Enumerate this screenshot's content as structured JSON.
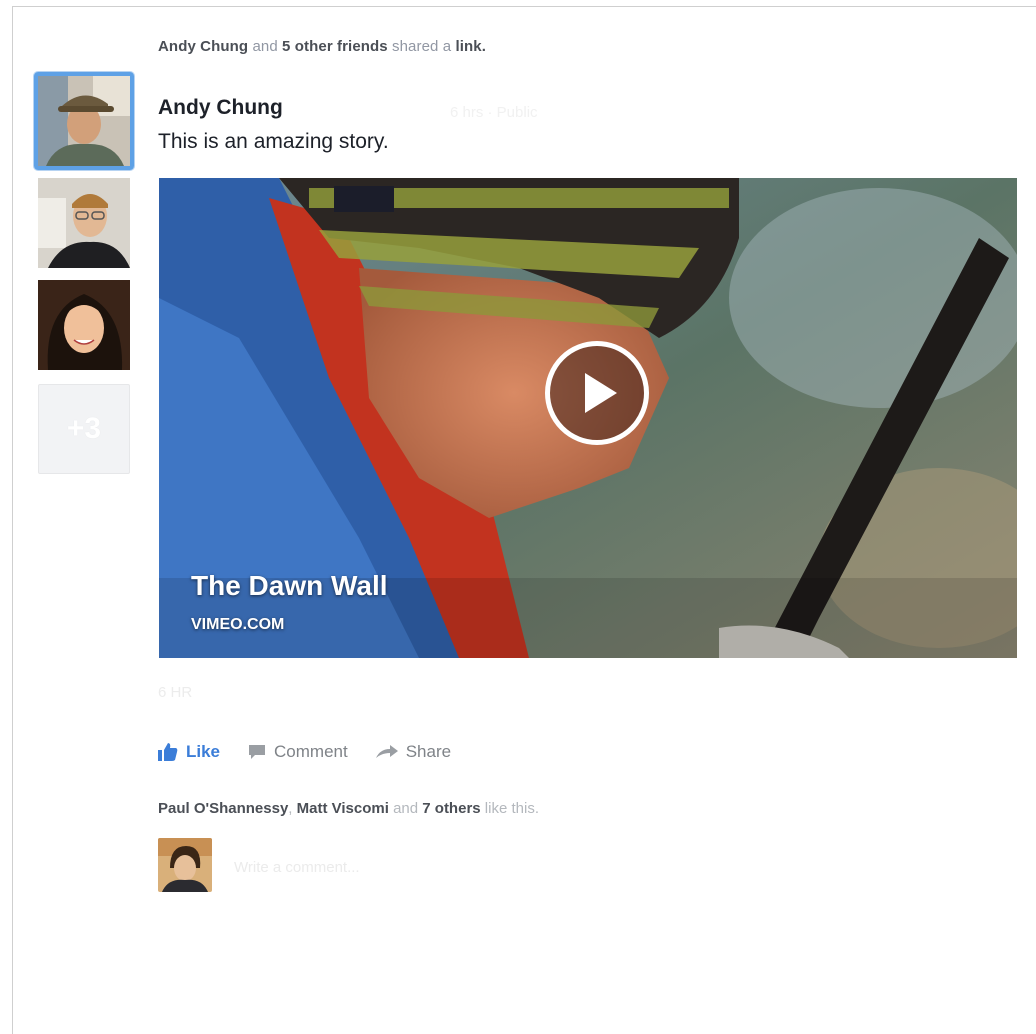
{
  "story": {
    "actor": "Andy Chung",
    "connector": "and",
    "others": "5 other friends",
    "verb": "shared a",
    "object": "link."
  },
  "friends_rail": {
    "more_label": "+3"
  },
  "post": {
    "author": "Andy Chung",
    "meta_faint": "6 hrs · Public",
    "message": "This is an amazing story."
  },
  "video": {
    "title": "The Dawn Wall",
    "source": "VIMEO.COM"
  },
  "timestamp_faint": "6 HR",
  "actions": {
    "like_label": "Like",
    "comment_label": "Comment",
    "share_label": "Share"
  },
  "likes": {
    "name1": "Paul O'Shannessy",
    "sep": ",",
    "name2": "Matt Viscomi",
    "connector": "and",
    "others": "7 others",
    "suffix": "like this."
  },
  "comment_box": {
    "placeholder": "Write a comment..."
  },
  "colors": {
    "accent": "#3b7dd8",
    "active_border": "#5ea1e6"
  }
}
